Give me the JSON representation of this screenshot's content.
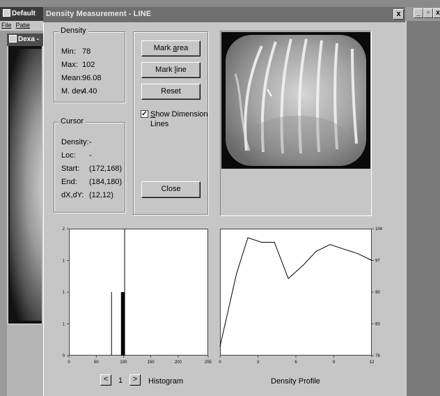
{
  "background_app": {
    "title": "Default",
    "menu": [
      "File",
      "Patie"
    ],
    "child_title": "Dexa -",
    "controls": [
      "_",
      "▫",
      "x"
    ]
  },
  "dialog": {
    "title": "Density Measurement - LINE",
    "close_glyph": "x"
  },
  "density": {
    "legend": "Density",
    "rows": [
      {
        "label": "Min:",
        "value": "78"
      },
      {
        "label": "Max:",
        "value": "102"
      },
      {
        "label": "Mean:",
        "value": "96.08"
      },
      {
        "label": "M. dev:",
        "value": "4.40"
      }
    ]
  },
  "cursor": {
    "legend": "Cursor",
    "rows": [
      {
        "label": "Density:",
        "value": "-"
      },
      {
        "label": "Loc:",
        "value": "-"
      },
      {
        "label": "Start:",
        "value": "(172,168)"
      },
      {
        "label": "End:",
        "value": "(184,180)"
      },
      {
        "label": "dX,dY:",
        "value": "(12,12)"
      }
    ]
  },
  "buttons": {
    "mark_area_pre": "Mark ",
    "mark_area_u": "a",
    "mark_area_post": "rea",
    "mark_line_pre": "Mark ",
    "mark_line_u": "l",
    "mark_line_post": "ine",
    "reset": "Reset",
    "close": "Close"
  },
  "show_dimension": {
    "checked": true,
    "check_glyph": "✓",
    "label_u": "S",
    "label_rest": "how Dimension Lines"
  },
  "footer": {
    "prev": "<",
    "page": "1",
    "next": ">",
    "histogram_label": "Histogram",
    "profile_label": "Density Profile"
  },
  "chart_data": [
    {
      "type": "bar",
      "xlim": [
        0,
        255
      ],
      "ylim": [
        0,
        2
      ],
      "xticks": [
        "0",
        "50",
        "100",
        "150",
        "200",
        "255"
      ],
      "yticks": [
        "0",
        "1",
        "1",
        "1",
        "2"
      ],
      "bars": [
        {
          "x": 78,
          "y": 1
        },
        {
          "x": 96,
          "y": 1
        },
        {
          "x": 97,
          "y": 1
        },
        {
          "x": 98,
          "y": 1
        },
        {
          "x": 99,
          "y": 1
        },
        {
          "x": 100,
          "y": 1
        },
        {
          "x": 101,
          "y": 1
        },
        {
          "x": 102,
          "y": 2
        }
      ],
      "grid": false
    },
    {
      "type": "line",
      "xlim": [
        0,
        12
      ],
      "ylim": [
        76,
        104
      ],
      "xticks": [
        "0",
        "3",
        "6",
        "9",
        "12"
      ],
      "yticks": [
        "76",
        "83",
        "90",
        "97",
        "104"
      ],
      "x": [
        0,
        1.3,
        2.2,
        3.3,
        4.3,
        5.4,
        6.6,
        7.6,
        8.7,
        9.8,
        10.9,
        12
      ],
      "y": [
        78,
        94,
        102,
        101,
        101,
        93,
        96,
        99,
        100.5,
        99.5,
        98.5,
        97
      ],
      "grid": false
    }
  ]
}
